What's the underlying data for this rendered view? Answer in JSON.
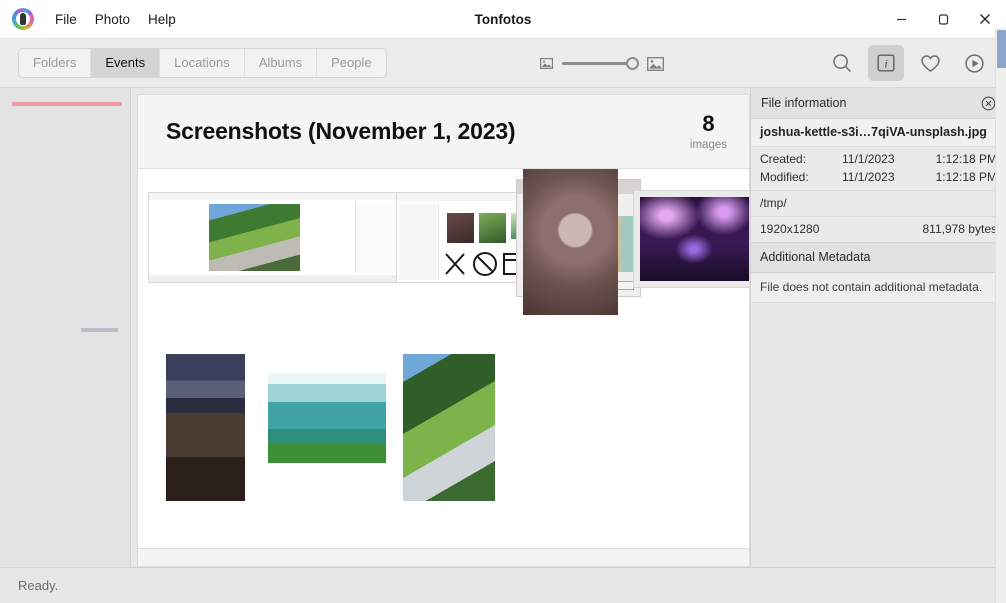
{
  "window": {
    "title": "Tonfotos",
    "app_icon": "tonfotos-logo-icon",
    "minimize_label": "Minimize",
    "maximize_label": "Maximize",
    "close_label": "Close"
  },
  "menu": {
    "items": [
      {
        "label": "File"
      },
      {
        "label": "Photo"
      },
      {
        "label": "Help"
      }
    ]
  },
  "toolbar": {
    "tabs": [
      {
        "label": "Folders",
        "active": false
      },
      {
        "label": "Events",
        "active": true
      },
      {
        "label": "Locations",
        "active": false
      },
      {
        "label": "Albums",
        "active": false
      },
      {
        "label": "People",
        "active": false
      }
    ],
    "zoom": {
      "small_icon": "small-image-icon",
      "large_icon": "large-image-icon",
      "value": 84
    },
    "buttons": [
      {
        "name": "search-button",
        "icon": "search-icon",
        "active": false
      },
      {
        "name": "info-button",
        "icon": "info-icon",
        "active": true
      },
      {
        "name": "favorites-button",
        "icon": "heart-icon",
        "active": false
      },
      {
        "name": "slideshow-button",
        "icon": "play-icon",
        "active": false
      }
    ]
  },
  "timeline_rail": {
    "current_marker": "current-event-marker",
    "other_marker": "other-event-marker"
  },
  "gallery": {
    "event_title": "Screenshots (November 1, 2023)",
    "count": "8",
    "count_label": "images",
    "thumbnails": [
      {
        "name": "thumbnail-tonfotos-viewer-screenshot",
        "selected": false
      },
      {
        "name": "thumbnail-tonfotos-library-screenshot",
        "selected": false
      },
      {
        "name": "thumbnail-ui-theme-dialog-screenshot",
        "selected": false
      },
      {
        "name": "thumbnail-wall-plate-shadow",
        "selected": false
      },
      {
        "name": "thumbnail-gardens-by-the-bay-night",
        "selected": true
      },
      {
        "name": "thumbnail-storm-over-plains",
        "selected": false
      },
      {
        "name": "thumbnail-underwater-diver",
        "selected": false
      },
      {
        "name": "thumbnail-arm-in-palm-leaves",
        "selected": false
      }
    ]
  },
  "info_panel": {
    "header": "File information",
    "close_icon": "close-circle-icon",
    "filename": "joshua-kettle-s3i…7qiVA-unsplash.jpg",
    "rows": [
      {
        "key": "Created:",
        "date": "11/1/2023",
        "time": "1:12:18 PM"
      },
      {
        "key": "Modified:",
        "date": "11/1/2023",
        "time": "1:12:18 PM"
      }
    ],
    "path": "/tmp/",
    "dimensions": "1920x1280",
    "filesize": "811,978 bytes",
    "additional_metadata_header": "Additional Metadata",
    "additional_metadata_note": "File does not contain additional metadata."
  },
  "statusbar": {
    "text": "Ready."
  },
  "colors": {
    "accent_current": "#f09aa2",
    "accent_other": "#b9bec6",
    "scrollbar": "#8da5c9",
    "tab_active_bg": "#d4d4d4"
  }
}
